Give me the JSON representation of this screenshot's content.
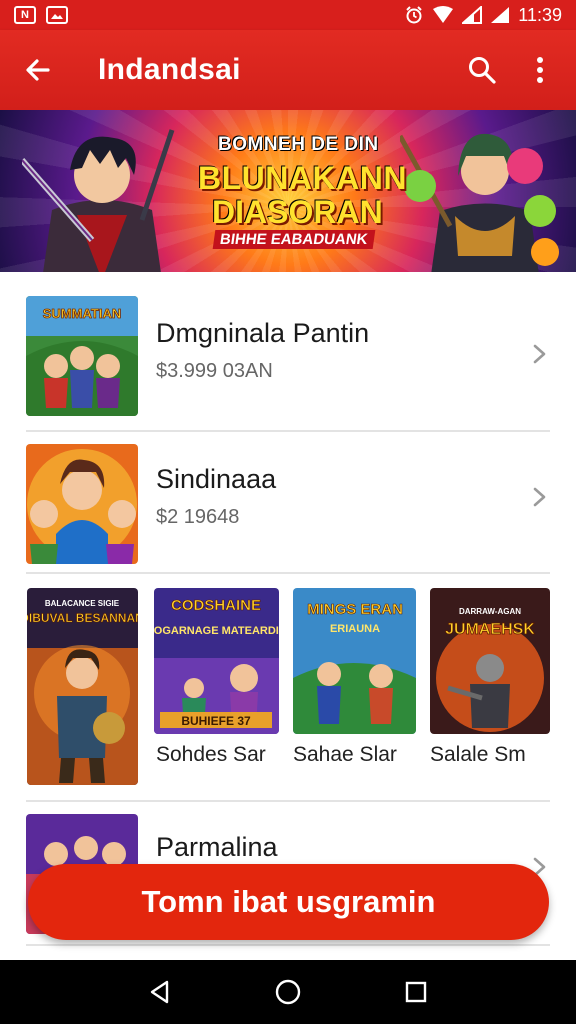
{
  "status_bar": {
    "left_icons": [
      "N",
      "image"
    ],
    "right_icons": [
      "alarm-icon",
      "wifi-icon",
      "signal-icon",
      "signal-icon-2"
    ],
    "time": "11:39"
  },
  "app_bar": {
    "title": "Indandsai",
    "back_icon": "arrow-left-icon",
    "search_icon": "search-icon",
    "menu_icon": "more-vertical-icon",
    "color": "#d81f1c"
  },
  "banner": {
    "small_line": "BOMNEH DE DIN",
    "line1": "BLUNAKANN",
    "line2": "DIASORAN",
    "subline": "BIHHE EABADUANK"
  },
  "list": [
    {
      "title": "Dmgninala Pantin",
      "price": "$3.999 03AN",
      "thumb_label": "SUMMATIAN"
    },
    {
      "title": "Sindinaaa",
      "price": "$2 19648",
      "thumb_label": ""
    }
  ],
  "grid": [
    {
      "label": "",
      "art_title": "DIBUVAL BESANNAN",
      "art_top": "BALACANCE SIGIE"
    },
    {
      "label": "Sohdes Sar",
      "art_title": "CODSHAINE",
      "art_top": "NOGARNAGE MATEARDIS",
      "art_bottom": "BUHIEFE 37"
    },
    {
      "label": "Sahae Slar",
      "art_title": "MINGS ERAN",
      "art_top": "ERIAUNA"
    },
    {
      "label": "Salale Sm",
      "art_title": "JUMAEHSK",
      "art_top": "DARRAW-AGAN"
    }
  ],
  "partial_row": {
    "title": "Parmalina"
  },
  "cta": {
    "label": "Tomn ibat usgramin",
    "color": "#e3260d"
  },
  "nav_bar": {
    "back": "back-triangle-icon",
    "home": "home-circle-icon",
    "recents": "recents-square-icon"
  }
}
